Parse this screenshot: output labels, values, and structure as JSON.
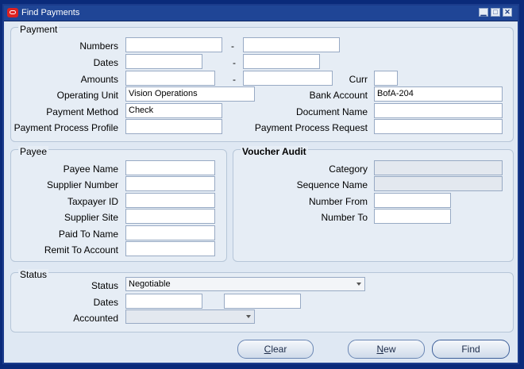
{
  "window": {
    "title": "Find Payments"
  },
  "payment": {
    "legend": "Payment",
    "numbers_label": "Numbers",
    "dates_label": "Dates",
    "amounts_label": "Amounts",
    "curr_label": "Curr",
    "operating_unit_label": "Operating Unit",
    "operating_unit_value": "Vision Operations",
    "bank_account_label": "Bank Account",
    "bank_account_value": "BofA-204",
    "payment_method_label": "Payment Method",
    "payment_method_value": "Check",
    "document_name_label": "Document Name",
    "ppp_label": "Payment Process Profile",
    "ppr_label": "Payment Process Request",
    "dash": "-"
  },
  "payee": {
    "legend": "Payee",
    "payee_name_label": "Payee Name",
    "supplier_number_label": "Supplier Number",
    "taxpayer_id_label": "Taxpayer ID",
    "supplier_site_label": "Supplier Site",
    "paid_to_name_label": "Paid To Name",
    "remit_to_label": "Remit To Account"
  },
  "voucher": {
    "legend": "Voucher Audit",
    "category_label": "Category",
    "sequence_label": "Sequence Name",
    "number_from_label": "Number From",
    "number_to_label": "Number To"
  },
  "status": {
    "legend": "Status",
    "status_label": "Status",
    "status_value": "Negotiable",
    "dates_label": "Dates",
    "accounted_label": "Accounted"
  },
  "buttons": {
    "clear_first": "C",
    "clear_rest": "lear",
    "new_first": "N",
    "new_rest": "ew",
    "find": "Find"
  }
}
